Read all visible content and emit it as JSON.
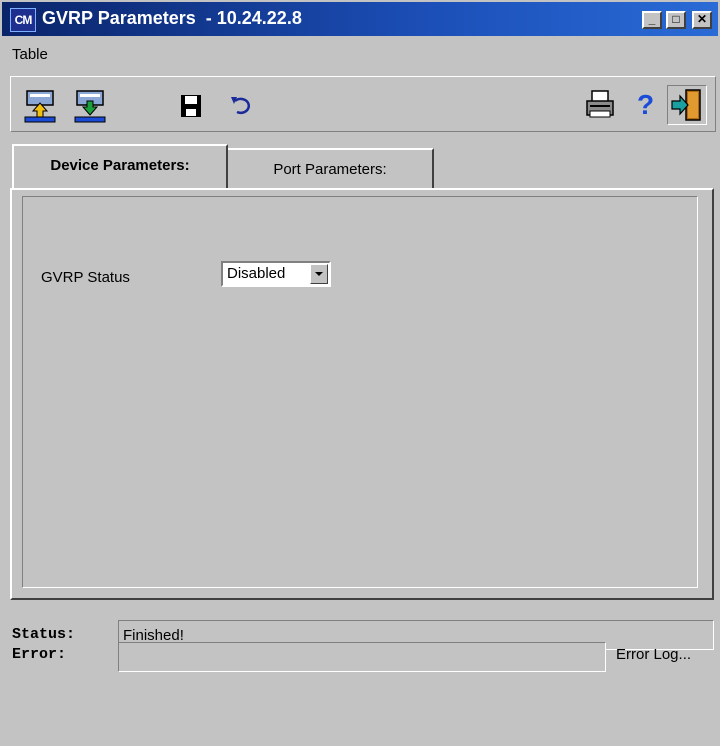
{
  "window": {
    "title": "GVRP Parameters  - 10.24.22.8",
    "app_icon_text": "CM",
    "controls": {
      "minimize": "_",
      "maximize": "□",
      "close": "✕"
    }
  },
  "menu": {
    "items": [
      "Table"
    ]
  },
  "toolbar": {
    "icons": [
      "upload-icon",
      "download-icon",
      "save-icon",
      "undo-icon",
      "print-icon",
      "help-icon",
      "exit-icon"
    ],
    "help_glyph": "?"
  },
  "tabs": [
    {
      "label": "Device Parameters:",
      "active": true
    },
    {
      "label": "Port Parameters:",
      "active": false
    }
  ],
  "device_params": {
    "gvrp_status_label": "GVRP Status",
    "gvrp_status_value": "Disabled"
  },
  "footer": {
    "status_label": "Status:",
    "status_value": "Finished!",
    "error_label": "Error:",
    "error_value": "",
    "error_log_label": "Error Log..."
  },
  "colors": {
    "titlebar_start": "#0a246a",
    "titlebar_end": "#2a6bd6",
    "surface": "#c3c3c3",
    "help_blue": "#1a4cd8",
    "upload_arrow": "#f2c010",
    "download_arrow": "#1aa03a",
    "exit_teal": "#1aa0a0"
  }
}
